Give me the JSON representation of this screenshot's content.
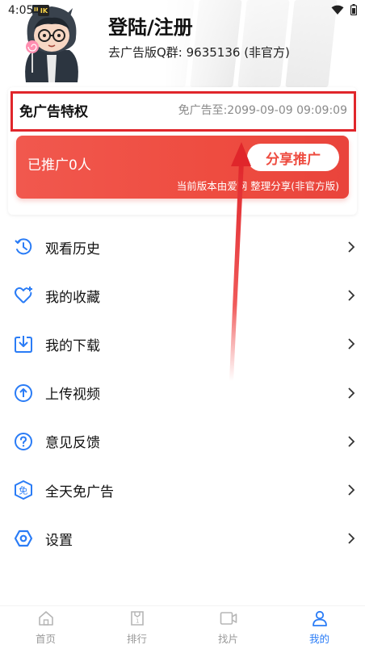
{
  "status_bar": {
    "time": "4:05",
    "app_icon_text": "IK"
  },
  "profile": {
    "title": "登陆/注册",
    "subtitle": "去广告版Q群: 9635136 (非官方)"
  },
  "privilege": {
    "title": "免广告特权",
    "expire_label": "免广告至:",
    "expire_value": "2099-09-09 09:09:09"
  },
  "promo": {
    "label": "已推广0人",
    "share_button": "分享推广",
    "note": "当前版本由爱网 整理分享(非官方版)"
  },
  "menu": {
    "items": [
      {
        "label": "观看历史",
        "icon": "history-icon"
      },
      {
        "label": "我的收藏",
        "icon": "heart-plus-icon"
      },
      {
        "label": "我的下载",
        "icon": "download-icon"
      },
      {
        "label": "上传视频",
        "icon": "upload-icon"
      },
      {
        "label": "意见反馈",
        "icon": "question-icon"
      },
      {
        "label": "全天免广告",
        "icon": "no-ads-icon"
      },
      {
        "label": "设置",
        "icon": "settings-hexagon-icon"
      }
    ]
  },
  "nav": {
    "items": [
      {
        "label": "首页",
        "icon": "home-icon"
      },
      {
        "label": "排行",
        "icon": "ranking-icon"
      },
      {
        "label": "找片",
        "icon": "video-icon"
      },
      {
        "label": "我的",
        "icon": "person-icon",
        "active": true
      }
    ]
  },
  "colors": {
    "accent": "#2a7cf6",
    "promo_red": "#ee4c40",
    "highlight_border": "#e0262b",
    "inactive_nav": "#9a9a9a"
  }
}
